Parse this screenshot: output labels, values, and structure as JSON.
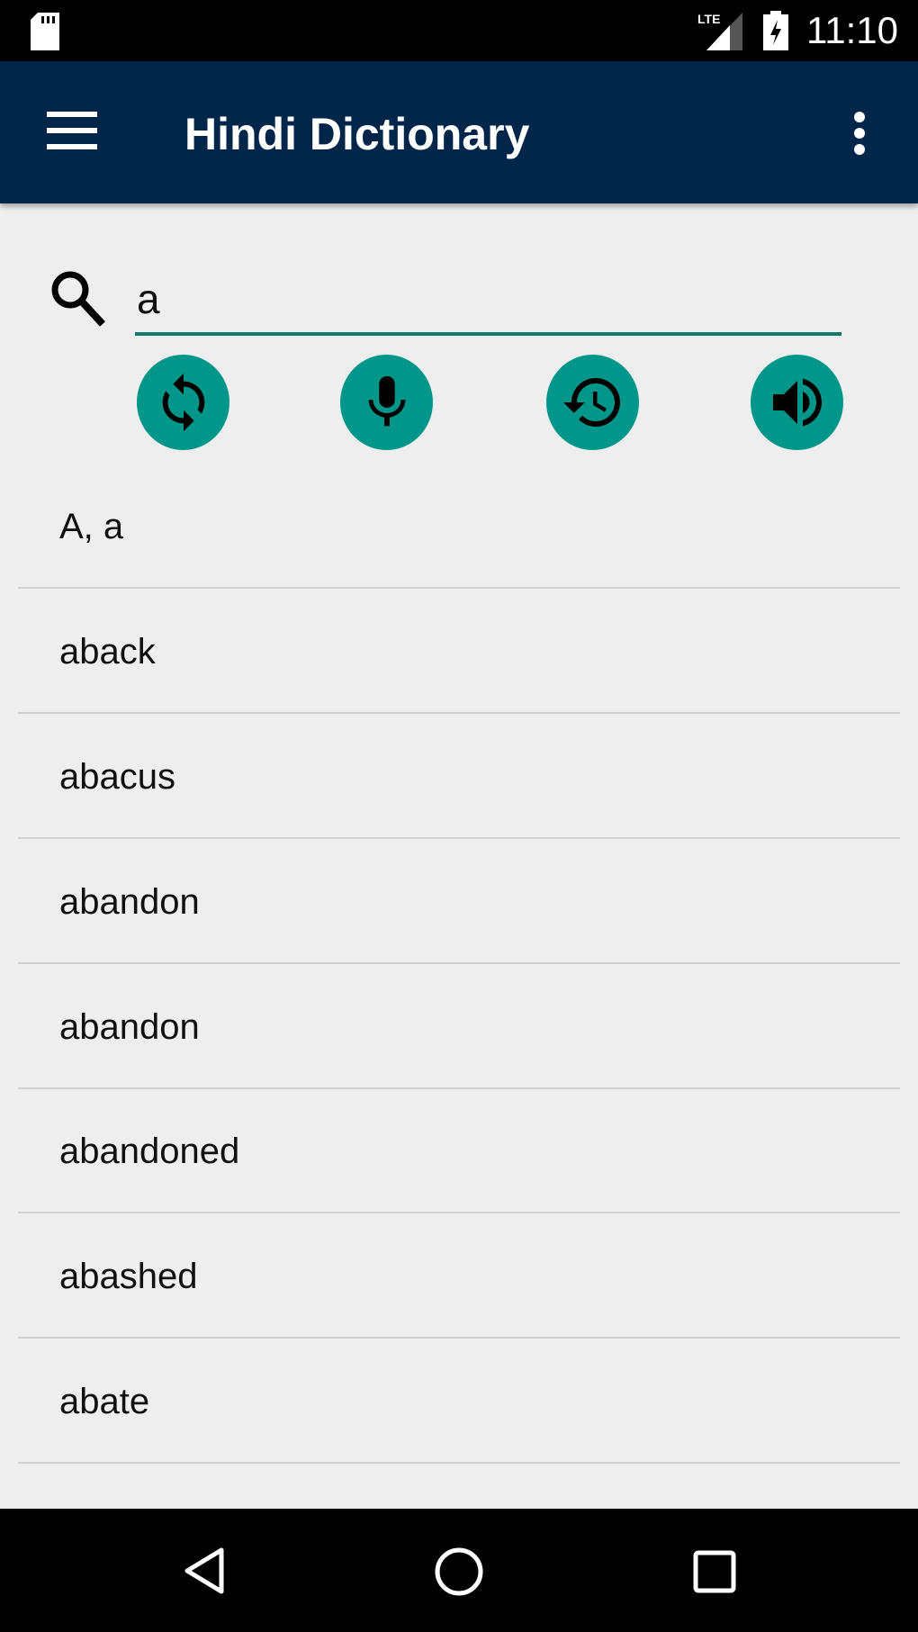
{
  "status_bar": {
    "time": "11:10",
    "network": "LTE",
    "icons": [
      "sd-card-icon",
      "signal-icon",
      "battery-charging-icon"
    ]
  },
  "app_bar": {
    "title": "Hindi Dictionary",
    "menu_icon": "hamburger-icon",
    "overflow_icon": "more-vert-icon"
  },
  "search": {
    "value": "a",
    "icon": "search-icon",
    "accent": "#00968a"
  },
  "actions": [
    {
      "icon": "sync-icon"
    },
    {
      "icon": "microphone-icon"
    },
    {
      "icon": "history-icon"
    },
    {
      "icon": "speaker-icon"
    }
  ],
  "results": [
    "A, a",
    "aback",
    "abacus",
    "abandon",
    "abandon",
    "abandoned",
    "abashed",
    "abate"
  ],
  "colors": {
    "app_bar": "#022649",
    "accent": "#00968a",
    "background": "#eeeeee"
  }
}
